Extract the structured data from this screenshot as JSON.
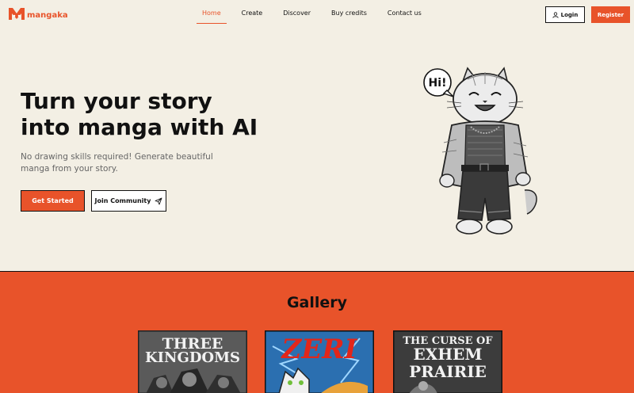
{
  "brand": {
    "name": "mangaka",
    "accent": "#e8532a",
    "background": "#f3efe4"
  },
  "nav": {
    "links": [
      "Home",
      "Create",
      "Discover",
      "Buy credits",
      "Contact us"
    ],
    "active": "Home",
    "login_label": "Login",
    "register_label": "Register"
  },
  "hero": {
    "title_line1": "Turn your story",
    "title_line2": "into manga with AI",
    "subtitle": "No drawing skills required! Generate beautiful manga from your story.",
    "primary_cta": "Get Started",
    "secondary_cta": "Join Community",
    "mascot_bubble": "Hi!"
  },
  "gallery": {
    "title": "Gallery",
    "covers": [
      {
        "line1": "THREE",
        "line2": "KINGDOMS"
      },
      {
        "line1": "ZERI",
        "line2": ""
      },
      {
        "line1": "THE CURSE OF",
        "line2": "EXHEM",
        "line3": "PRAIRIE"
      }
    ]
  }
}
